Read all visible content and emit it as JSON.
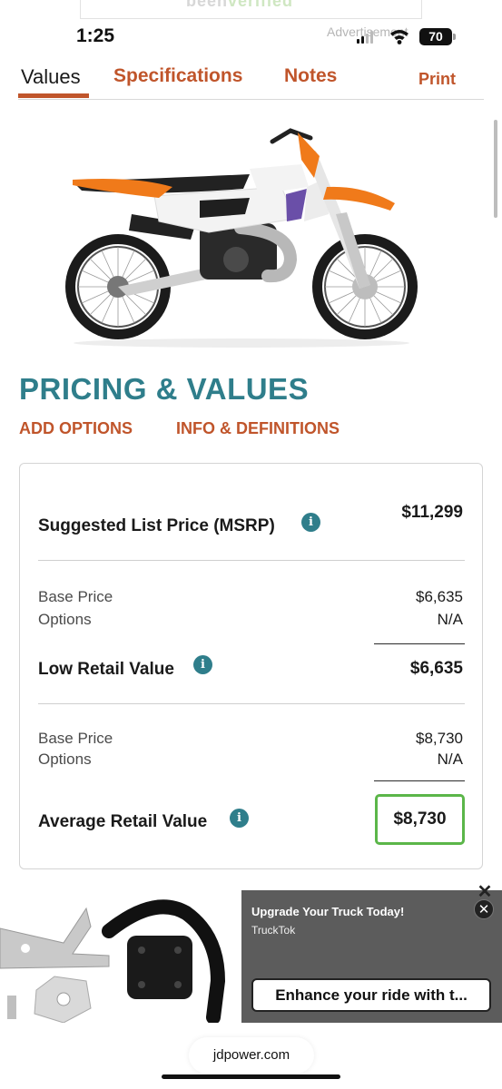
{
  "top_ad": {
    "brand_a": "been",
    "brand_b": "verified"
  },
  "status_bar": {
    "time": "1:25",
    "ad_overlay": "Advertisement",
    "battery": "70"
  },
  "tabs": {
    "values": "Values",
    "specifications": "Specifications",
    "notes": "Notes",
    "print": "Print"
  },
  "pricing": {
    "title": "PRICING & VALUES",
    "add_options": "ADD OPTIONS",
    "info_definitions": "INFO & DEFINITIONS",
    "msrp_label": "Suggested List Price (MSRP)",
    "msrp_value": "$11,299",
    "low": {
      "base_label": "Base Price",
      "base_value": "$6,635",
      "options_label": "Options",
      "options_value": "N/A",
      "label": "Low Retail Value",
      "value": "$6,635"
    },
    "average": {
      "base_label": "Base Price",
      "base_value": "$8,730",
      "options_label": "Options",
      "options_value": "N/A",
      "label": "Average Retail Value",
      "value": "$8,730"
    },
    "info_glyph": "i"
  },
  "bottom_ad": {
    "title": "Upgrade Your Truck Today!",
    "source": "TruckTok",
    "cta": "Enhance your ride with t..."
  },
  "browser": {
    "url": "jdpower.com"
  },
  "colors": {
    "accent_orange": "#c0552b",
    "teal": "#2f7e8b",
    "highlight_green": "#5bb649"
  }
}
